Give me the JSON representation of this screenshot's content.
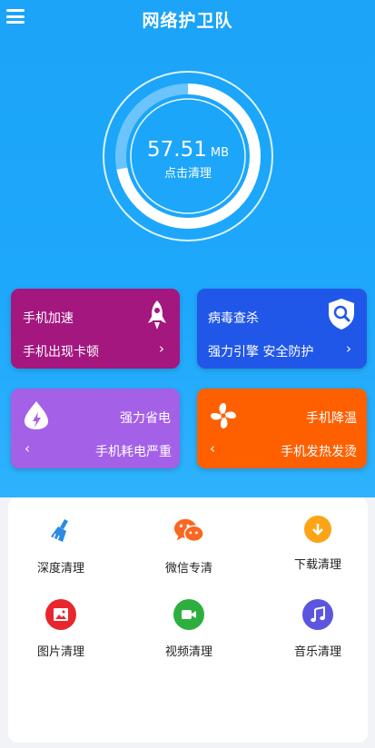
{
  "header": {
    "title": "网络护卫队",
    "menu_icon": "hamburger-menu-icon"
  },
  "gauge": {
    "value": "57.51",
    "unit": "MB",
    "action_label": "点击清理",
    "progress": 0.72
  },
  "cards": [
    {
      "id": "phone-speed",
      "title": "手机加速",
      "subtitle": "手机出现卡顿",
      "icon": "rocket-icon",
      "color": "#a3177f"
    },
    {
      "id": "virus-kill",
      "title": "病毒查杀",
      "subtitle": "强力引擎 安全防护",
      "icon": "shield-search-icon",
      "color": "#2157e8"
    },
    {
      "id": "power-save",
      "title": "强力省电",
      "subtitle": "手机耗电严重",
      "icon": "battery-drop-icon",
      "color": "#a560e8"
    },
    {
      "id": "cool-down",
      "title": "手机降温",
      "subtitle": "手机发热发烫",
      "icon": "fan-icon",
      "color": "#fe6000"
    }
  ],
  "tools": [
    {
      "label": "深度清理",
      "icon": "broom-icon",
      "color": "#2a8ae4"
    },
    {
      "label": "微信专清",
      "icon": "wechat-icon",
      "color": "#fb6621"
    },
    {
      "label": "下载清理",
      "icon": "download-icon",
      "color": "#fba416"
    },
    {
      "label": "图片清理",
      "icon": "image-icon",
      "color": "#e9262d"
    },
    {
      "label": "视频清理",
      "icon": "video-icon",
      "color": "#2daf3f"
    },
    {
      "label": "音乐清理",
      "icon": "music-icon",
      "color": "#5b55e0"
    }
  ]
}
